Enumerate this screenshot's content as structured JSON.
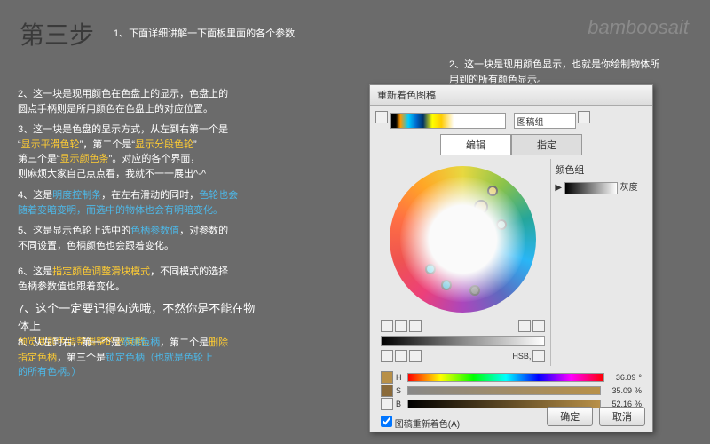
{
  "title": "第三步",
  "watermark": "bamboosait",
  "notes": {
    "n1": "1、下面详细讲解一下面板里面的各个参数",
    "nr_a": "2、这一块是现用颜色显示，也就是你绘制物体所",
    "nr_b": "用到的所有颜色显示。",
    "n2_a": "2、这一块是现用颜色在色盘上的显示，色盘上的",
    "n2_b": "圆点手柄则是所用颜色在色盘上的对应位置。",
    "n3_a": "3、这一块是色盘的显示方式，从左到右第一个是",
    "n3_b1": "“",
    "n3_b2": "显示平滑色轮",
    "n3_b3": "”，第二个是“",
    "n3_b4": "显示分段色轮",
    "n3_b5": "”",
    "n3_c1": "第三个是“",
    "n3_c2": "显示颜色条",
    "n3_c3": "”。对应的各个界面，",
    "n3_d": "则麻烦大家自己点点看，我就不一一展出^-^",
    "n4_a1": "4、这是",
    "n4_a2": "明度控制条",
    "n4_a3": "，在左右滑动的同时，",
    "n4_a4": "色轮也会",
    "n4_b": "随着变暗变明，而选中的物体也会有明暗变化。",
    "n5_a1": "5、这是显示色轮上选中的",
    "n5_a2": "色柄参数值",
    "n5_a3": "，对参数的",
    "n5_b": "不同设置，色柄颜色也会跟着变化。",
    "n6_a1": "6、这是",
    "n6_a2": "指定颜色调整滑块模式",
    "n6_a3": "，不同模式的选择",
    "n6_b": "色柄参数值也跟着变化。",
    "n7_a": "7、这个一定要记得勾选哦，不然你是不能在物体上",
    "n7_b": "预览到颜色调整调整的效果哟。",
    "n8_a1": "8、从左到右，第一个是",
    "n8_a2": "添加色柄",
    "n8_a3": "，第二个是",
    "n8_a4": "删除",
    "n8_b1": "指定色柄",
    "n8_b2": "，第三个是",
    "n8_b3": "锁定色柄（也就是色轮上",
    "n8_c": "的所有色柄。）"
  },
  "panel": {
    "title": "重新着色图稿",
    "dropdown": "图稿组",
    "tab_edit": "编辑",
    "tab_assign": "指定",
    "side_label": "颜色组",
    "side_item": "灰度",
    "hsb": {
      "h": "H",
      "s": "S",
      "b": "B",
      "hv": "36.09",
      "sv": "35.09",
      "bv": "52.16",
      "pct1": "°",
      "pct2": "%",
      "pct3": "%"
    },
    "checkbox": "图稿重新着色(A)",
    "ok": "确定",
    "cancel": "取消",
    "hsb_label": "HSB,"
  }
}
